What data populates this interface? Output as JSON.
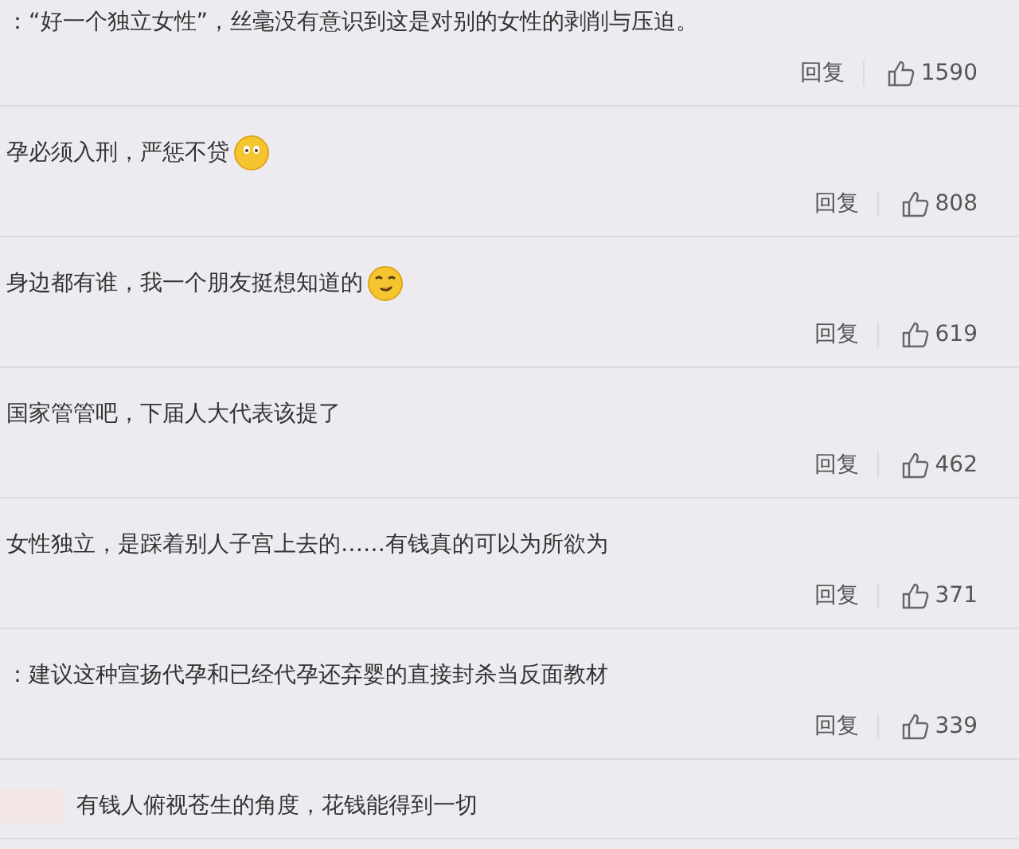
{
  "comments": [
    {
      "kind": "plain",
      "text": "：“好一个独立女性”，丝毫没有意识到这是对别的女性的剥削与压迫。",
      "reply": "回复",
      "likes": "1590"
    },
    {
      "kind": "smiley",
      "text": "孕必须入刑，严惩不贷",
      "reply": "回复",
      "likes": "808"
    },
    {
      "kind": "grin",
      "text": "身边都有谁，我一个朋友挺想知道的",
      "reply": "回复",
      "likes": "619"
    },
    {
      "kind": "plain",
      "text": "国家管管吧，下届人大代表该提了",
      "reply": "回复",
      "likes": "462"
    },
    {
      "kind": "plain",
      "text": "女性独立，是踩着别人子宫上去的……有钱真的可以为所欲为",
      "reply": "回复",
      "likes": "371"
    },
    {
      "kind": "plain",
      "text": "：建议这种宣扬代孕和已经代孕还弃婴的直接封杀当反面教材",
      "reply": "回复",
      "likes": "339"
    },
    {
      "kind": "hidden-name",
      "text": "有钱人俯视苍生的角度，花钱能得到一切"
    }
  ]
}
